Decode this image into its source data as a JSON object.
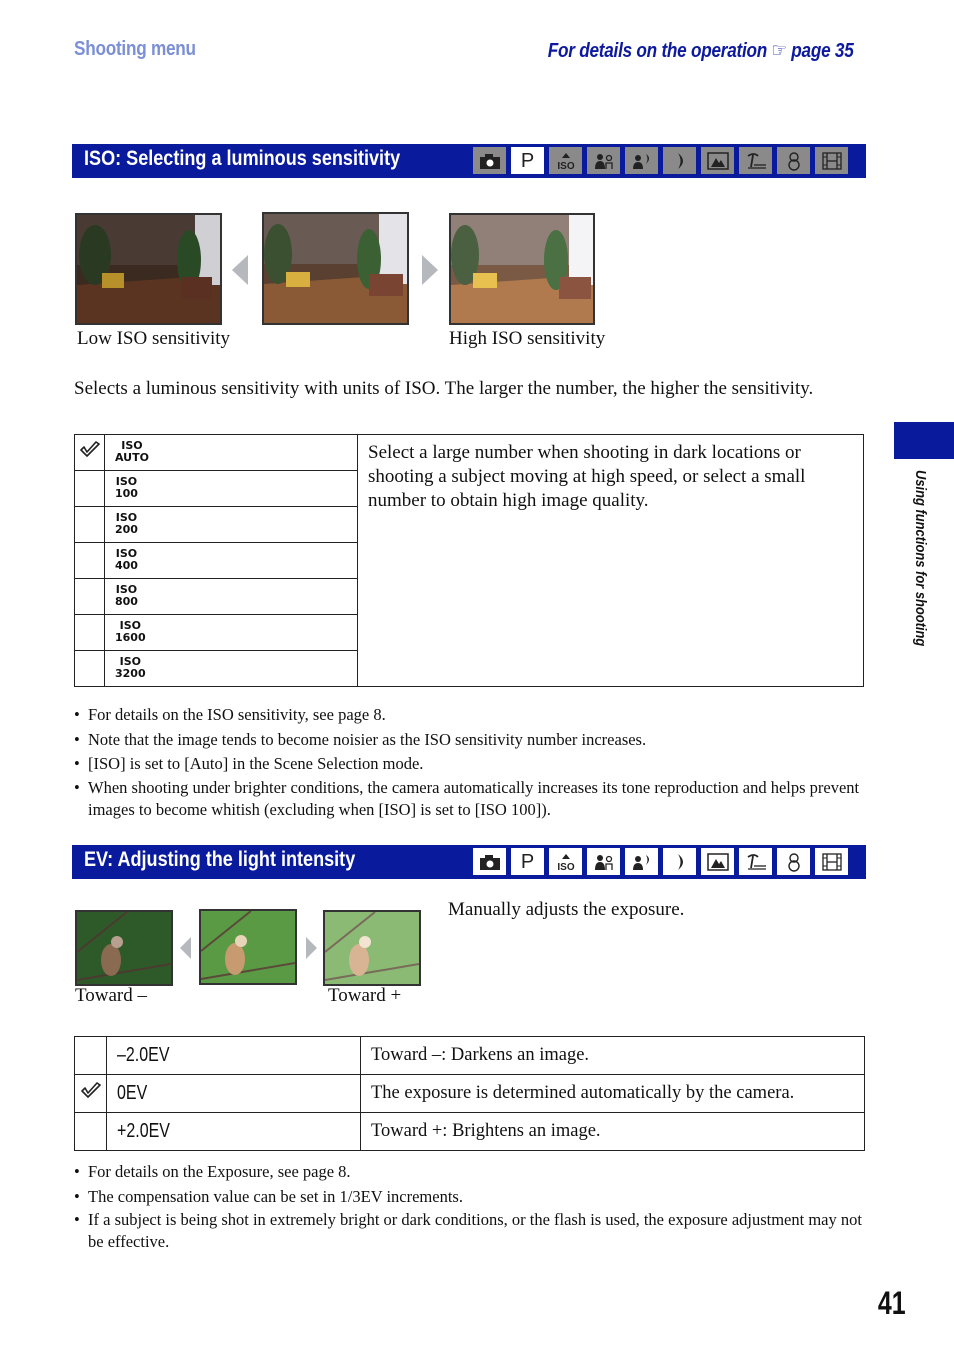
{
  "header": {
    "section": "Shooting menu",
    "operation_ref": "For details on the operation",
    "ref_icon": "pointing-hand-icon",
    "ref_glyph": "☞",
    "ref_page": "page 35"
  },
  "colors": {
    "brand_blue": "#0a1a9c",
    "header_light_blue": "#7b8fd6",
    "icon_inactive": "#8a8a8a",
    "icon_active": "#ffffff"
  },
  "mode_icons": [
    {
      "name": "auto-camera-icon"
    },
    {
      "name": "program-p-icon",
      "label": "P"
    },
    {
      "name": "high-sensitivity-iso-icon"
    },
    {
      "name": "soft-snap-icon"
    },
    {
      "name": "twilight-portrait-icon"
    },
    {
      "name": "twilight-icon"
    },
    {
      "name": "landscape-icon"
    },
    {
      "name": "beach-icon"
    },
    {
      "name": "snow-icon"
    },
    {
      "name": "movie-icon"
    }
  ],
  "iso_section": {
    "title": "ISO: Selecting a luminous sensitivity",
    "active_modes": [
      "P"
    ],
    "images": {
      "low_caption": "Low ISO sensitivity",
      "high_caption": "High ISO sensitivity"
    },
    "intro": "Selects a luminous sensitivity with units of ISO. The larger the number, the higher the sensitivity.",
    "options": [
      {
        "line1": "ISO",
        "line2": "AUTO",
        "selected": true
      },
      {
        "line1": "ISO",
        "line2": "100",
        "selected": false
      },
      {
        "line1": "ISO",
        "line2": "200",
        "selected": false
      },
      {
        "line1": "ISO",
        "line2": "400",
        "selected": false
      },
      {
        "line1": "ISO",
        "line2": "800",
        "selected": false
      },
      {
        "line1": "ISO",
        "line2": "1600",
        "selected": false
      },
      {
        "line1": "ISO",
        "line2": "3200",
        "selected": false
      }
    ],
    "description": "Select a large number when shooting in dark locations or shooting a subject moving at high speed, or select a small number to obtain high image quality.",
    "notes": [
      "For details on the ISO sensitivity, see page 8.",
      "Note that the image tends to become noisier as the ISO sensitivity number increases.",
      "[ISO] is set to [Auto] in the Scene Selection mode.",
      "When shooting under brighter conditions, the camera automatically increases its tone reproduction and helps prevent images to become whitish (excluding when [ISO] is set to [ISO 100])."
    ]
  },
  "ev_section": {
    "title": "EV: Adjusting the light intensity",
    "active_modes": [
      "all"
    ],
    "images": {
      "minus_caption": "Toward –",
      "plus_caption": "Toward +"
    },
    "intro": "Manually adjusts the exposure.",
    "rows": [
      {
        "value": "–2.0EV",
        "description": "Toward –: Darkens an image.",
        "selected": false
      },
      {
        "value": "0EV",
        "description": "The exposure is determined automatically by the camera.",
        "selected": true
      },
      {
        "value": "+2.0EV",
        "description": "Toward +: Brightens an image.",
        "selected": false
      }
    ],
    "notes": [
      "For details on the Exposure, see page 8.",
      "The compensation value can be set in 1/3EV increments.",
      "If a subject is being shot in extremely bright or dark conditions, or the flash is used, the exposure adjustment may not be effective."
    ]
  },
  "side_tab": {
    "label": "Using functions for shooting"
  },
  "page_number": "41"
}
